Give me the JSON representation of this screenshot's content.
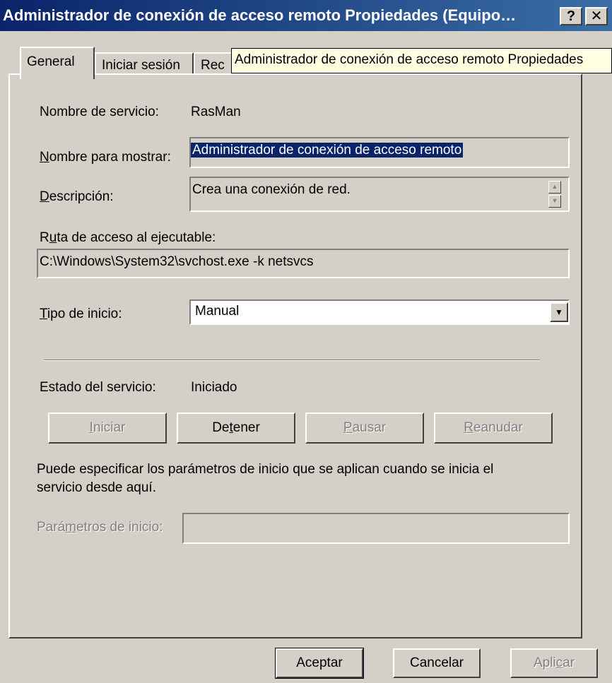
{
  "window": {
    "title": "Administrador de conexión de acceso remoto Propiedades (Equipo…",
    "help_button": "?",
    "close_button": "✕"
  },
  "tabs": [
    {
      "label": "General",
      "active": true
    },
    {
      "label": "Iniciar sesión",
      "active": false
    },
    {
      "label": "Rec",
      "active": false
    }
  ],
  "tooltip": "Administrador de conexión de acceso remoto Propiedades",
  "general": {
    "service_name_label": "Nombre de servicio:",
    "service_name_value": "RasMan",
    "display_name_label_u": "N",
    "display_name_label_rest": "ombre para mostrar:",
    "display_name_value": "Administrador de conexión de acceso remoto",
    "description_label_u": "D",
    "description_label_rest": "escripción:",
    "description_value": "Crea una conexión de red.",
    "path_label_pre": "R",
    "path_label_u": "u",
    "path_label_rest": "ta de acceso al ejecutable:",
    "path_value": "C:\\Windows\\System32\\svchost.exe -k netsvcs",
    "startup_type_label_u": "T",
    "startup_type_label_rest": "ipo de inicio:",
    "startup_type_value": "Manual",
    "status_label": "Estado del servicio:",
    "status_value": "Iniciado",
    "start_button_u": "I",
    "start_button_rest": "niciar",
    "stop_button_pre": "De",
    "stop_button_u": "t",
    "stop_button_rest": "ener",
    "pause_button_u": "P",
    "pause_button_rest": "ausar",
    "resume_button_u": "R",
    "resume_button_rest": "eanudar",
    "help_text_line1": "Puede especificar los parámetros de inicio que se aplican cuando se inicia el",
    "help_text_line2": "servicio desde aquí.",
    "params_label_pre": "Pará",
    "params_label_u": "m",
    "params_label_rest": "etros de inicio:",
    "params_value": ""
  },
  "footer": {
    "ok": "Aceptar",
    "cancel": "Cancelar",
    "apply_pre": "Apli",
    "apply_u": "c",
    "apply_rest": "ar"
  }
}
